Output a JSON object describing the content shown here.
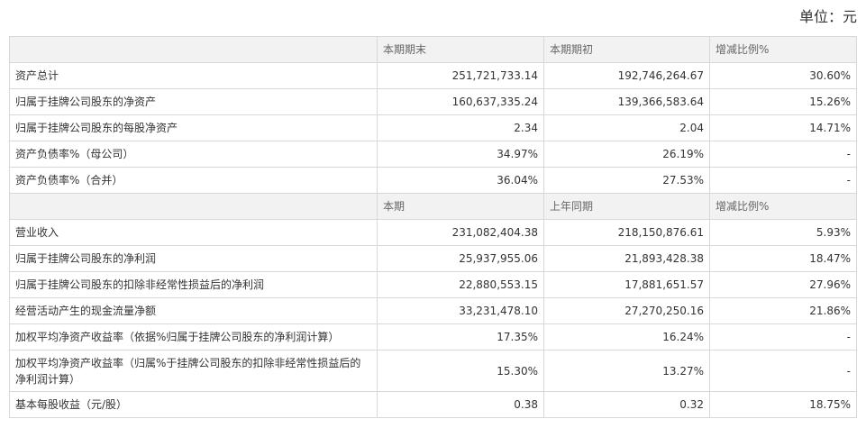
{
  "unit_label": "单位：元",
  "section1": {
    "headers": [
      "",
      "本期期末",
      "本期期初",
      "增减比例%"
    ],
    "rows": [
      {
        "label": "资产总计",
        "current": "251,721,733.14",
        "previous": "192,746,264.67",
        "change": "30.60%"
      },
      {
        "label": "归属于挂牌公司股东的净资产",
        "current": "160,637,335.24",
        "previous": "139,366,583.64",
        "change": "15.26%"
      },
      {
        "label": "归属于挂牌公司股东的每股净资产",
        "current": "2.34",
        "previous": "2.04",
        "change": "14.71%"
      },
      {
        "label": "资产负债率%（母公司）",
        "current": "34.97%",
        "previous": "26.19%",
        "change": "-"
      },
      {
        "label": "资产负债率%（合并）",
        "current": "36.04%",
        "previous": "27.53%",
        "change": "-"
      }
    ]
  },
  "section2": {
    "headers": [
      "",
      "本期",
      "上年同期",
      "增减比例%"
    ],
    "rows": [
      {
        "label": "营业收入",
        "current": "231,082,404.38",
        "previous": "218,150,876.61",
        "change": "5.93%"
      },
      {
        "label": "归属于挂牌公司股东的净利润",
        "current": "25,937,955.06",
        "previous": "21,893,428.38",
        "change": "18.47%"
      },
      {
        "label": "归属于挂牌公司股东的扣除非经常性损益后的净利润",
        "current": "22,880,553.15",
        "previous": "17,881,651.57",
        "change": "27.96%"
      },
      {
        "label": "经营活动产生的现金流量净额",
        "current": "33,231,478.10",
        "previous": "27,270,250.16",
        "change": "21.86%"
      },
      {
        "label": "加权平均净资产收益率（依据%归属于挂牌公司股东的净利润计算）",
        "current": "17.35%",
        "previous": "16.24%",
        "change": "-"
      },
      {
        "label": "加权平均净资产收益率（归属%于挂牌公司股东的扣除非经常性损益后的净利润计算）",
        "current": "15.30%",
        "previous": "13.27%",
        "change": "-"
      },
      {
        "label": "基本每股收益（元/股）",
        "current": "0.38",
        "previous": "0.32",
        "change": "18.75%"
      }
    ]
  }
}
